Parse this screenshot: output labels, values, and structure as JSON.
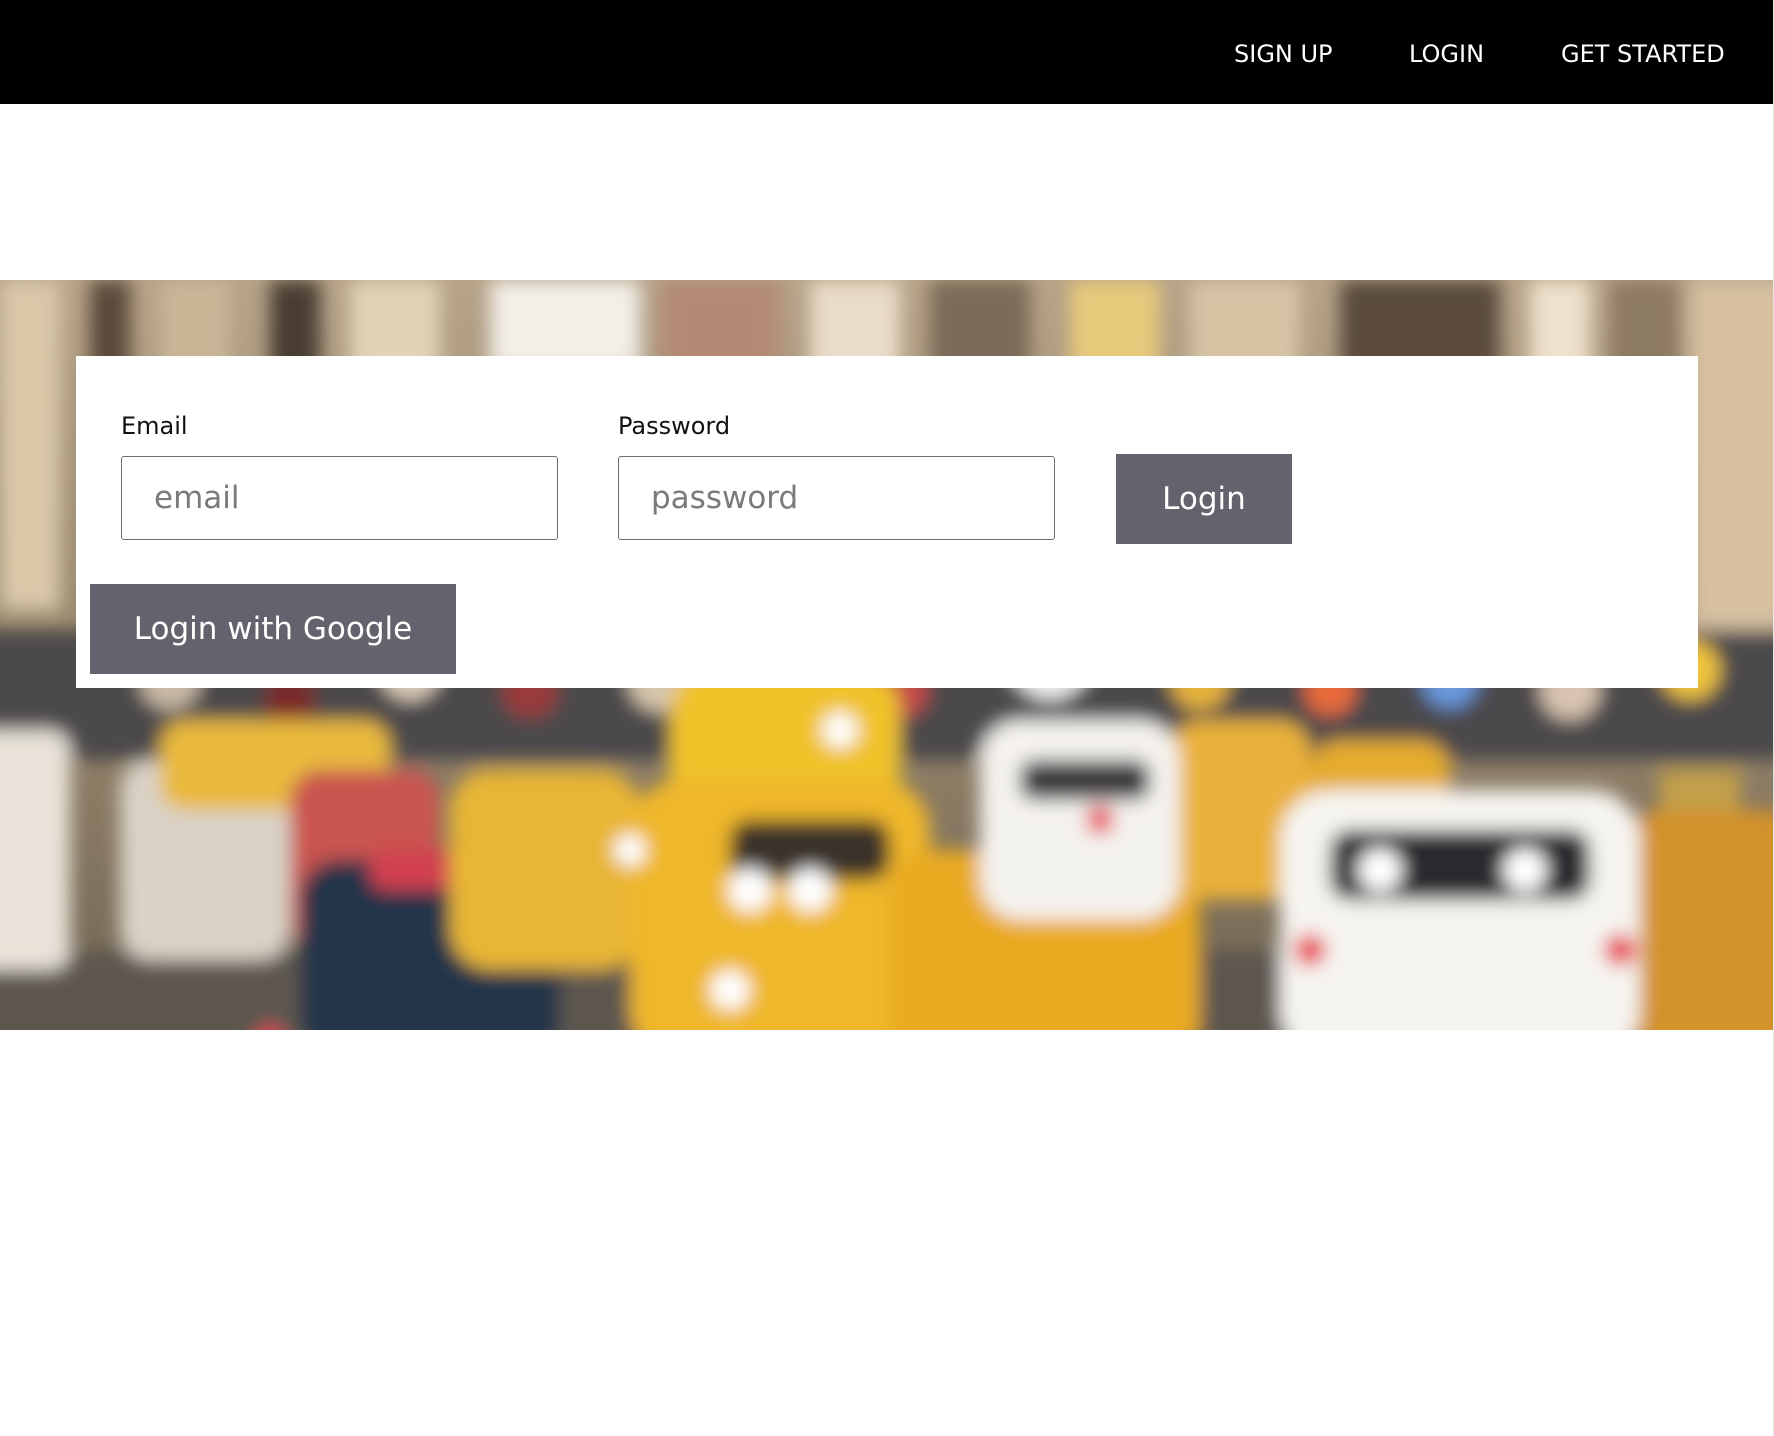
{
  "nav": {
    "links": [
      {
        "label": "SIGN UP"
      },
      {
        "label": "LOGIN"
      },
      {
        "label": "GET STARTED"
      }
    ],
    "background_color": "#000000",
    "text_color": "#ffffff"
  },
  "hero": {
    "background": "blurred city street with yellow taxis"
  },
  "login_form": {
    "email": {
      "label": "Email",
      "placeholder": "email",
      "value": ""
    },
    "password": {
      "label": "Password",
      "placeholder": "password",
      "value": ""
    },
    "login_button": "Login",
    "google_button": "Login with Google",
    "button_color": "#62636c"
  }
}
